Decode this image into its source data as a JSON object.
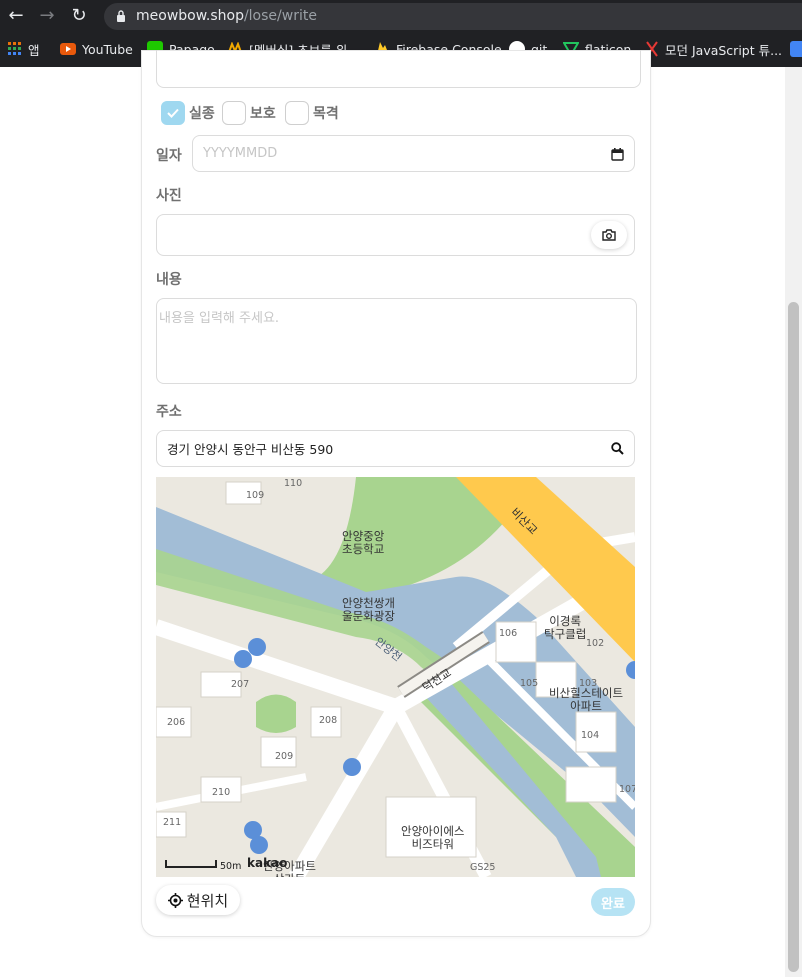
{
  "browser": {
    "url_host": "meowbow.shop",
    "url_path": "/lose/write",
    "bookmarks": [
      {
        "label": "앱",
        "color": "#e8710a"
      },
      {
        "label": "YouTube",
        "color": "#e8590c"
      },
      {
        "label": "Papago",
        "color": "#1ec800"
      },
      {
        "label": "[멤버십] 초보를 위...",
        "color": "#f2a900"
      },
      {
        "label": "Firebase Console",
        "color": "#ffca28"
      },
      {
        "label": "git",
        "color": "#ffffff"
      },
      {
        "label": "flaticon",
        "color": "#22c55e"
      },
      {
        "label": "모던 JavaScript 튜...",
        "color": "#e53935"
      }
    ]
  },
  "form": {
    "types": [
      {
        "label": "실종",
        "checked": true
      },
      {
        "label": "보호",
        "checked": false
      },
      {
        "label": "목격",
        "checked": false
      }
    ],
    "date_label": "일자",
    "date_placeholder": "YYYYMMDD",
    "photo_label": "사진",
    "content_label": "내용",
    "content_placeholder": "내용을 입력해 주세요.",
    "address_label": "주소",
    "address_value": "경기 안양시 동안구 비산동 590"
  },
  "map": {
    "labels": {
      "school": "안양중앙\n초등학교",
      "plaza": "안양천쌍개\n울문화광장",
      "river": "안양천",
      "bridge1": "비산교",
      "bridge2": "덕천교",
      "club": "이경록\n탁구클럽",
      "apt": "비산힐스테이트\n아파트",
      "biz": "안양아이에스\n비즈타워",
      "gs": "GS25",
      "apt2": "안양아파트\n상가동",
      "b109": "109",
      "b110": "110",
      "b106": "106",
      "b102": "102",
      "b105": "105",
      "b103": "103",
      "b104": "104",
      "b107": "107",
      "b207": "207",
      "b206": "206",
      "b208": "208",
      "b209": "209",
      "b210": "210",
      "b211": "211"
    },
    "scale": "50m",
    "brand": "kakao"
  },
  "actions": {
    "current_location": "현위치",
    "submit": "완료"
  },
  "colors": {
    "accent": "#9fd8f0",
    "submit_bg": "#b6e3f4",
    "river": "#a2bdd6",
    "bridge_road": "#ffc94d",
    "park": "#a8d48f"
  }
}
